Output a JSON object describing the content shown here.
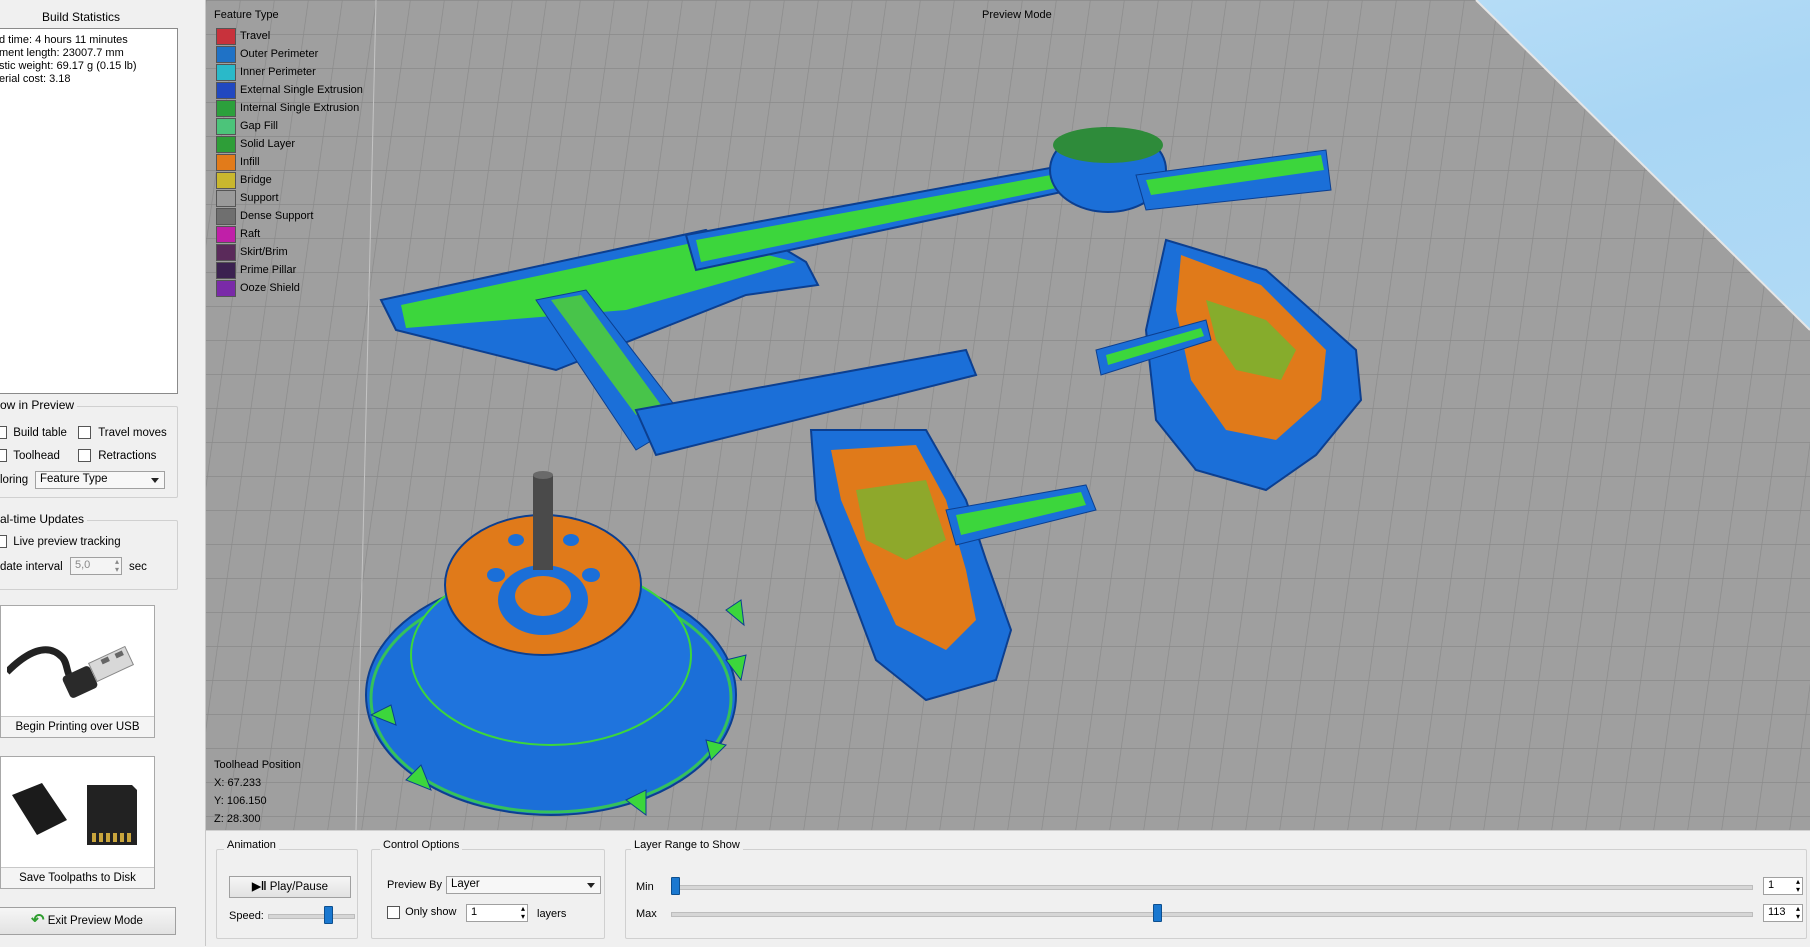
{
  "build_statistics": {
    "title": "Build Statistics",
    "lines": [
      "d time: 4 hours 11 minutes",
      "ment length: 23007.7 mm",
      "stic weight: 69.17 g (0.15 lb)",
      "erial cost: 3.18"
    ]
  },
  "show_in_preview": {
    "title": "ow in Preview",
    "build_table": "Build table",
    "travel_moves": "Travel moves",
    "toolhead": "Toolhead",
    "retractions": "Retractions",
    "coloring_label": "loring",
    "coloring_value": "Feature Type"
  },
  "realtime": {
    "title": "al-time Updates",
    "live_tracking": "Live preview tracking",
    "interval_label": "date interval",
    "interval_value": "5,0",
    "interval_unit": "sec"
  },
  "buttons": {
    "usb": "Begin Printing over USB",
    "sd": "Save Toolpaths to Disk",
    "exit": "Exit Preview Mode"
  },
  "viewport": {
    "mode": "Preview Mode",
    "legend_title": "Feature Type",
    "legend": [
      {
        "label": "Travel",
        "color": "#c8323c"
      },
      {
        "label": "Outer Perimeter",
        "color": "#1f72c6"
      },
      {
        "label": "Inner Perimeter",
        "color": "#2ab9c9"
      },
      {
        "label": "External Single Extrusion",
        "color": "#2148c0"
      },
      {
        "label": "Internal Single Extrusion",
        "color": "#2ca03c"
      },
      {
        "label": "Gap Fill",
        "color": "#4cc47a"
      },
      {
        "label": "Solid Layer",
        "color": "#2e9e38"
      },
      {
        "label": "Infill",
        "color": "#e27b1a"
      },
      {
        "label": "Bridge",
        "color": "#c9b72e"
      },
      {
        "label": "Support",
        "color": "#9a9a9a"
      },
      {
        "label": "Dense Support",
        "color": "#6f6f6f"
      },
      {
        "label": "Raft",
        "color": "#c01fa8"
      },
      {
        "label": "Skirt/Brim",
        "color": "#5a2a5a"
      },
      {
        "label": "Prime Pillar",
        "color": "#3b2150"
      },
      {
        "label": "Ooze Shield",
        "color": "#7a2aa8"
      }
    ],
    "toolhead_title": "Toolhead Position",
    "x": "X: 67.233",
    "y": "Y: 106.150",
    "z": "Z: 28.300"
  },
  "animation": {
    "title": "Animation",
    "play_pause": "Play/Pause",
    "speed_label": "Speed:",
    "speed_level": 0.7
  },
  "control_options": {
    "title": "Control Options",
    "preview_by_label": "Preview By",
    "preview_by_value": "Layer",
    "only_show_label": "Only show",
    "only_show_value": "1",
    "layers_label": "layers"
  },
  "layer_range": {
    "title": "Layer Range to Show",
    "min_label": "Min",
    "max_label": "Max",
    "min_value": "1",
    "max_value": "113",
    "max_level": 0.45
  }
}
